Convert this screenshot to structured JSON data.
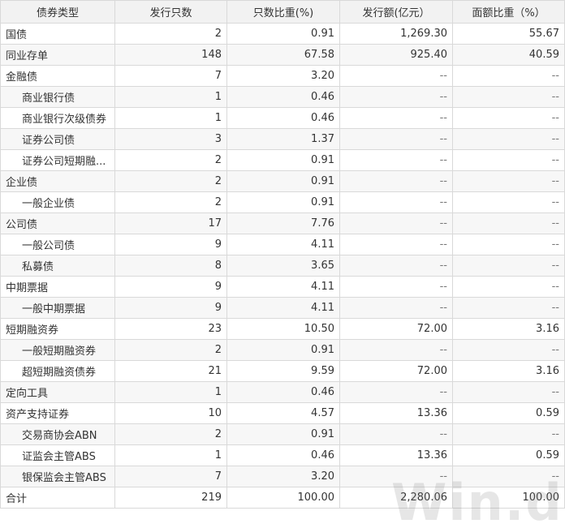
{
  "table": {
    "headers": [
      "债券类型",
      "发行只数",
      "只数比重(%)",
      "发行额(亿元）",
      "面额比重（%）"
    ],
    "rows": [
      {
        "name": "国债",
        "indent": false,
        "count": "2",
        "count_pct": "0.91",
        "amount": "1,269.30",
        "amount_pct": "55.67"
      },
      {
        "name": "同业存单",
        "indent": false,
        "count": "148",
        "count_pct": "67.58",
        "amount": "925.40",
        "amount_pct": "40.59"
      },
      {
        "name": "金融债",
        "indent": false,
        "count": "7",
        "count_pct": "3.20",
        "amount": "--",
        "amount_pct": "--"
      },
      {
        "name": "商业银行债",
        "indent": true,
        "count": "1",
        "count_pct": "0.46",
        "amount": "--",
        "amount_pct": "--"
      },
      {
        "name": "商业银行次级债券",
        "indent": true,
        "count": "1",
        "count_pct": "0.46",
        "amount": "--",
        "amount_pct": "--"
      },
      {
        "name": "证券公司债",
        "indent": true,
        "count": "3",
        "count_pct": "1.37",
        "amount": "--",
        "amount_pct": "--"
      },
      {
        "name": "证券公司短期融...",
        "indent": true,
        "count": "2",
        "count_pct": "0.91",
        "amount": "--",
        "amount_pct": "--"
      },
      {
        "name": "企业债",
        "indent": false,
        "count": "2",
        "count_pct": "0.91",
        "amount": "--",
        "amount_pct": "--"
      },
      {
        "name": "一般企业债",
        "indent": true,
        "count": "2",
        "count_pct": "0.91",
        "amount": "--",
        "amount_pct": "--"
      },
      {
        "name": "公司债",
        "indent": false,
        "count": "17",
        "count_pct": "7.76",
        "amount": "--",
        "amount_pct": "--"
      },
      {
        "name": "一般公司债",
        "indent": true,
        "count": "9",
        "count_pct": "4.11",
        "amount": "--",
        "amount_pct": "--"
      },
      {
        "name": "私募债",
        "indent": true,
        "count": "8",
        "count_pct": "3.65",
        "amount": "--",
        "amount_pct": "--"
      },
      {
        "name": "中期票据",
        "indent": false,
        "count": "9",
        "count_pct": "4.11",
        "amount": "--",
        "amount_pct": "--"
      },
      {
        "name": "一般中期票据",
        "indent": true,
        "count": "9",
        "count_pct": "4.11",
        "amount": "--",
        "amount_pct": "--"
      },
      {
        "name": "短期融资券",
        "indent": false,
        "count": "23",
        "count_pct": "10.50",
        "amount": "72.00",
        "amount_pct": "3.16"
      },
      {
        "name": "一般短期融资券",
        "indent": true,
        "count": "2",
        "count_pct": "0.91",
        "amount": "--",
        "amount_pct": "--"
      },
      {
        "name": "超短期融资债券",
        "indent": true,
        "count": "21",
        "count_pct": "9.59",
        "amount": "72.00",
        "amount_pct": "3.16"
      },
      {
        "name": "定向工具",
        "indent": false,
        "count": "1",
        "count_pct": "0.46",
        "amount": "--",
        "amount_pct": "--"
      },
      {
        "name": "资产支持证券",
        "indent": false,
        "count": "10",
        "count_pct": "4.57",
        "amount": "13.36",
        "amount_pct": "0.59"
      },
      {
        "name": "交易商协会ABN",
        "indent": true,
        "count": "2",
        "count_pct": "0.91",
        "amount": "--",
        "amount_pct": "--"
      },
      {
        "name": "证监会主管ABS",
        "indent": true,
        "count": "1",
        "count_pct": "0.46",
        "amount": "13.36",
        "amount_pct": "0.59"
      },
      {
        "name": "银保监会主管ABS",
        "indent": true,
        "count": "7",
        "count_pct": "3.20",
        "amount": "--",
        "amount_pct": "--"
      },
      {
        "name": "合计",
        "indent": false,
        "count": "219",
        "count_pct": "100.00",
        "amount": "2,280.06",
        "amount_pct": "100.00"
      }
    ]
  },
  "watermark": "Win.d"
}
